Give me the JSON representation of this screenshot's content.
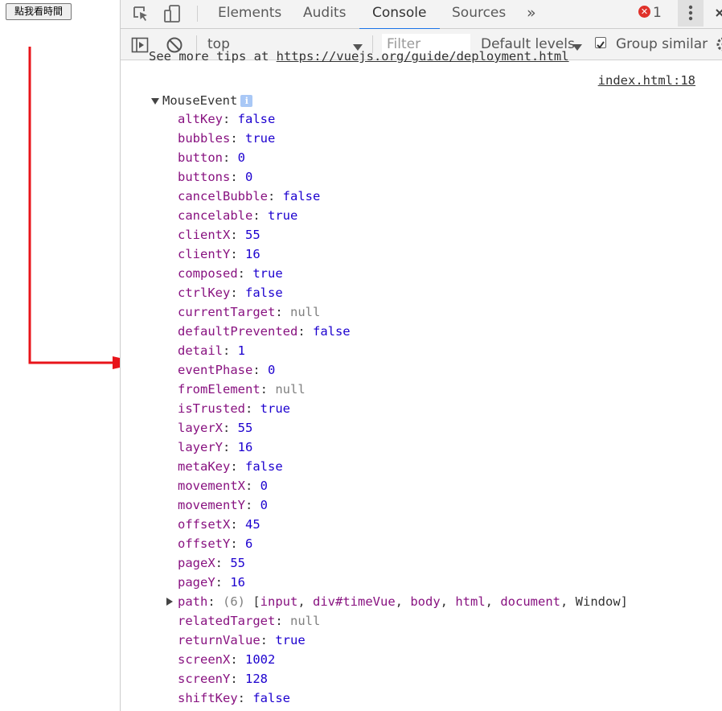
{
  "page": {
    "button_label": "點我看時間"
  },
  "devtools": {
    "tabs": [
      {
        "label": "Elements",
        "active": false
      },
      {
        "label": "Audits",
        "active": false
      },
      {
        "label": "Console",
        "active": true
      },
      {
        "label": "Sources",
        "active": false
      }
    ],
    "more_tabs": "»",
    "error_count": "1",
    "console_toolbar": {
      "context": "top",
      "filter_placeholder": "Filter",
      "levels_label": "Default levels",
      "group_similar_label": "Group similar",
      "group_similar_checked": true
    },
    "accent_color": "#1a73e8"
  },
  "console": {
    "cut_line_prefix": "See more tips at ",
    "cut_line_link": "https://vuejs.org/guide/deployment.html",
    "source_link": "index.html:18",
    "object_name": "MouseEvent",
    "info_badge": "i",
    "properties": [
      {
        "key": "altKey",
        "value": "false",
        "type": "bool"
      },
      {
        "key": "bubbles",
        "value": "true",
        "type": "bool"
      },
      {
        "key": "button",
        "value": "0",
        "type": "num"
      },
      {
        "key": "buttons",
        "value": "0",
        "type": "num"
      },
      {
        "key": "cancelBubble",
        "value": "false",
        "type": "bool"
      },
      {
        "key": "cancelable",
        "value": "true",
        "type": "bool"
      },
      {
        "key": "clientX",
        "value": "55",
        "type": "num"
      },
      {
        "key": "clientY",
        "value": "16",
        "type": "num"
      },
      {
        "key": "composed",
        "value": "true",
        "type": "bool"
      },
      {
        "key": "ctrlKey",
        "value": "false",
        "type": "bool"
      },
      {
        "key": "currentTarget",
        "value": "null",
        "type": "null"
      },
      {
        "key": "defaultPrevented",
        "value": "false",
        "type": "bool"
      },
      {
        "key": "detail",
        "value": "1",
        "type": "num"
      },
      {
        "key": "eventPhase",
        "value": "0",
        "type": "num"
      },
      {
        "key": "fromElement",
        "value": "null",
        "type": "null"
      },
      {
        "key": "isTrusted",
        "value": "true",
        "type": "bool"
      },
      {
        "key": "layerX",
        "value": "55",
        "type": "num"
      },
      {
        "key": "layerY",
        "value": "16",
        "type": "num"
      },
      {
        "key": "metaKey",
        "value": "false",
        "type": "bool"
      },
      {
        "key": "movementX",
        "value": "0",
        "type": "num"
      },
      {
        "key": "movementY",
        "value": "0",
        "type": "num"
      },
      {
        "key": "offsetX",
        "value": "45",
        "type": "num"
      },
      {
        "key": "offsetY",
        "value": "6",
        "type": "num"
      },
      {
        "key": "pageX",
        "value": "55",
        "type": "num"
      },
      {
        "key": "pageY",
        "value": "16",
        "type": "num"
      },
      {
        "key": "path",
        "type": "path",
        "count": "(6)",
        "items": [
          "input",
          "div#timeVue",
          "body",
          "html",
          "document",
          "Window"
        ]
      },
      {
        "key": "relatedTarget",
        "value": "null",
        "type": "null"
      },
      {
        "key": "returnValue",
        "value": "true",
        "type": "bool"
      },
      {
        "key": "screenX",
        "value": "1002",
        "type": "num"
      },
      {
        "key": "screenY",
        "value": "128",
        "type": "num"
      },
      {
        "key": "shiftKey",
        "value": "false",
        "type": "bool"
      }
    ]
  },
  "annotation": {
    "arrow_color": "#e8141a"
  }
}
